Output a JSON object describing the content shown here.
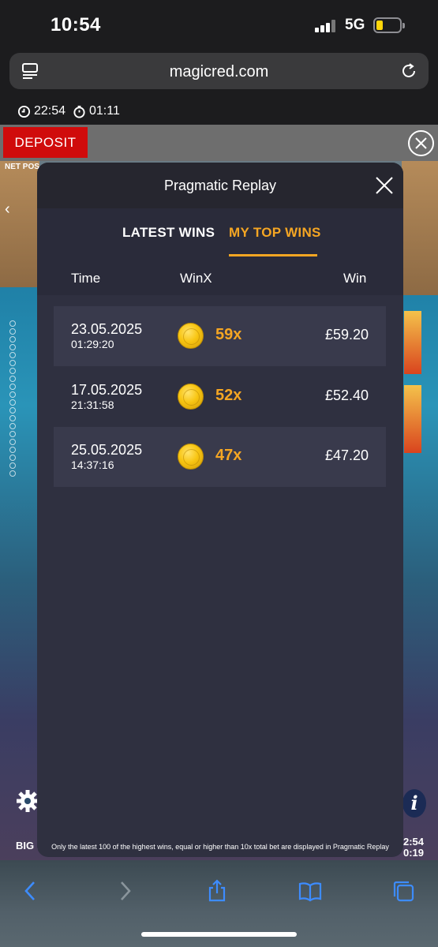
{
  "status_bar": {
    "time": "10:54",
    "network": "5G",
    "battery_level": 0.25
  },
  "browser": {
    "url": "magicred.com"
  },
  "session_timer": {
    "clock_time": "22:54",
    "session_duration": "01:11"
  },
  "site": {
    "deposit_label": "DEPOSIT"
  },
  "game": {
    "net_position_label": "NET POS",
    "bottom_left_label": "BIG I",
    "right_clock_line1": "2:54",
    "right_clock_line2": "0:19"
  },
  "modal": {
    "title": "Pragmatic Replay",
    "tabs": [
      {
        "label": "LATEST WINS",
        "active": false
      },
      {
        "label": "MY TOP WINS",
        "active": true
      }
    ],
    "columns": {
      "time": "Time",
      "winx": "WinX",
      "win": "Win"
    },
    "rows": [
      {
        "date": "23.05.2025",
        "time": "01:29:20",
        "multiplier": "59x",
        "amount": "£59.20"
      },
      {
        "date": "17.05.2025",
        "time": "21:31:58",
        "multiplier": "52x",
        "amount": "£52.40"
      },
      {
        "date": "25.05.2025",
        "time": "14:37:16",
        "multiplier": "47x",
        "amount": "£47.20"
      }
    ],
    "footnote": "Only the latest 100 of the highest wins, equal or higher than 10x total bet are displayed in Pragmatic Replay"
  },
  "colors": {
    "accent": "#f5a623",
    "deposit_red": "#d00b0b",
    "modal_bg": "#2f3040",
    "row_shade": "#393a4c"
  },
  "icons": {
    "tabs_icon": "tabs-icon",
    "reload_icon": "reload-icon",
    "back_icon": "back-icon",
    "forward_icon": "forward-icon",
    "share_icon": "share-icon",
    "bookmarks_icon": "bookmarks-icon"
  }
}
